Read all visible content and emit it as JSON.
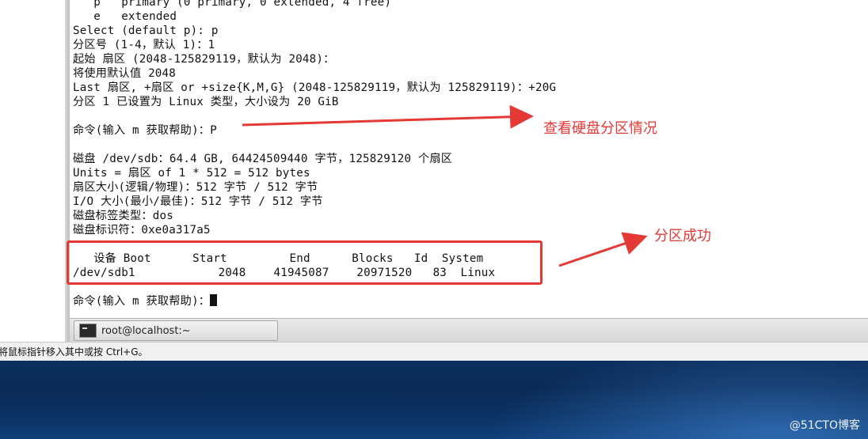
{
  "terminal": {
    "lines": [
      "   p   primary (0 primary, 0 extended, 4 free)",
      "   e   extended",
      "Select (default p): p",
      "分区号 (1-4，默认 1)：1",
      "起始 扇区 (2048-125829119，默认为 2048)：",
      "将使用默认值 2048",
      "Last 扇区, +扇区 or +size{K,M,G} (2048-125829119，默认为 125829119)：+20G",
      "分区 1 已设置为 Linux 类型，大小设为 20 GiB",
      "",
      "命令(输入 m 获取帮助)：P",
      "",
      "磁盘 /dev/sdb：64.4 GB, 64424509440 字节，125829120 个扇区",
      "Units = 扇区 of 1 * 512 = 512 bytes",
      "扇区大小(逻辑/物理)：512 字节 / 512 字节",
      "I/O 大小(最小/最佳)：512 字节 / 512 字节",
      "磁盘标签类型：dos",
      "磁盘标识符：0xe0a317a5",
      "",
      "   设备 Boot      Start         End      Blocks   Id  System",
      "/dev/sdb1            2048    41945087    20971520   83  Linux",
      "",
      "命令(输入 m 获取帮助)："
    ]
  },
  "annotations": {
    "view_partition": "查看硬盘分区情况",
    "partition_success": "分区成功",
    "color": "#e53935"
  },
  "taskbar": {
    "item_label": "root@localhost:~",
    "item_icon": "terminal-icon"
  },
  "status_bar": {
    "text": "将鼠标指针移入其中或按 Ctrl+G。"
  },
  "watermark": "@51CTO博客"
}
